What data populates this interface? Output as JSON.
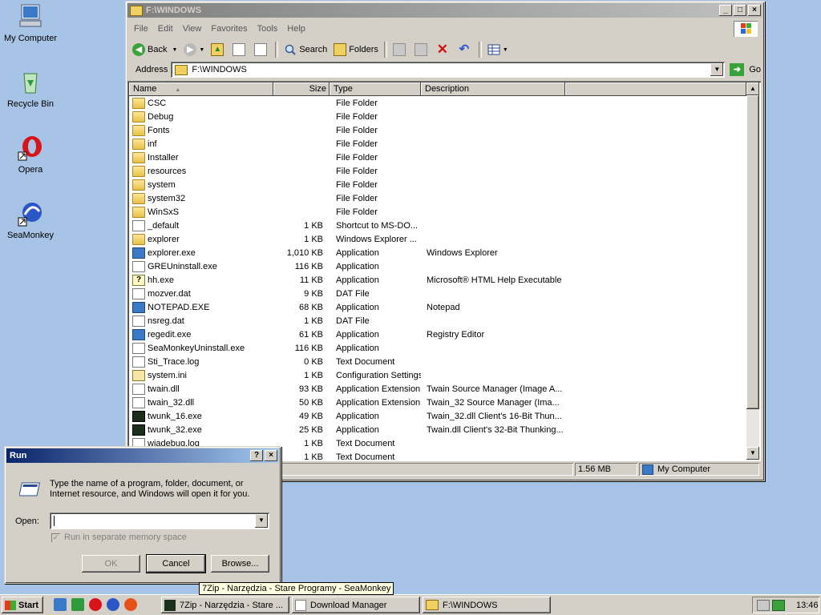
{
  "desktop": {
    "icons": [
      {
        "label": "My Computer"
      },
      {
        "label": "Recycle Bin"
      },
      {
        "label": "Opera"
      },
      {
        "label": "SeaMonkey"
      }
    ]
  },
  "explorer": {
    "title": "F:\\WINDOWS",
    "menu": [
      "File",
      "Edit",
      "View",
      "Favorites",
      "Tools",
      "Help"
    ],
    "toolbar": {
      "back": "Back",
      "search": "Search",
      "folders": "Folders"
    },
    "address": {
      "label": "Address",
      "value": "F:\\WINDOWS",
      "go": "Go"
    },
    "columns": {
      "name": "Name",
      "size": "Size",
      "type": "Type",
      "description": "Description"
    },
    "files": [
      {
        "name": "CSC",
        "size": "",
        "type": "File Folder",
        "desc": "",
        "icon": "folder"
      },
      {
        "name": "Debug",
        "size": "",
        "type": "File Folder",
        "desc": "",
        "icon": "folder"
      },
      {
        "name": "Fonts",
        "size": "",
        "type": "File Folder",
        "desc": "",
        "icon": "folder"
      },
      {
        "name": "inf",
        "size": "",
        "type": "File Folder",
        "desc": "",
        "icon": "folder"
      },
      {
        "name": "Installer",
        "size": "",
        "type": "File Folder",
        "desc": "",
        "icon": "folder"
      },
      {
        "name": "resources",
        "size": "",
        "type": "File Folder",
        "desc": "",
        "icon": "folder"
      },
      {
        "name": "system",
        "size": "",
        "type": "File Folder",
        "desc": "",
        "icon": "folder"
      },
      {
        "name": "system32",
        "size": "",
        "type": "File Folder",
        "desc": "",
        "icon": "folder"
      },
      {
        "name": "WinSxS",
        "size": "",
        "type": "File Folder",
        "desc": "",
        "icon": "folder"
      },
      {
        "name": "_default",
        "size": "1 KB",
        "type": "Shortcut to MS-DO...",
        "desc": "",
        "icon": "file"
      },
      {
        "name": "explorer",
        "size": "1 KB",
        "type": "Windows Explorer ...",
        "desc": "",
        "icon": "folder"
      },
      {
        "name": "explorer.exe",
        "size": "1,010 KB",
        "type": "Application",
        "desc": "Windows Explorer",
        "icon": "app"
      },
      {
        "name": "GREUninstall.exe",
        "size": "116 KB",
        "type": "Application",
        "desc": "",
        "icon": "file"
      },
      {
        "name": "hh.exe",
        "size": "11 KB",
        "type": "Application",
        "desc": "Microsoft® HTML Help Executable",
        "icon": "help"
      },
      {
        "name": "mozver.dat",
        "size": "9 KB",
        "type": "DAT File",
        "desc": "",
        "icon": "file"
      },
      {
        "name": "NOTEPAD.EXE",
        "size": "68 KB",
        "type": "Application",
        "desc": "Notepad",
        "icon": "app"
      },
      {
        "name": "nsreg.dat",
        "size": "1 KB",
        "type": "DAT File",
        "desc": "",
        "icon": "file"
      },
      {
        "name": "regedit.exe",
        "size": "61 KB",
        "type": "Application",
        "desc": "Registry Editor",
        "icon": "app"
      },
      {
        "name": "SeaMonkeyUninstall.exe",
        "size": "116 KB",
        "type": "Application",
        "desc": "",
        "icon": "file"
      },
      {
        "name": "Sti_Trace.log",
        "size": "0 KB",
        "type": "Text Document",
        "desc": "",
        "icon": "file"
      },
      {
        "name": "system.ini",
        "size": "1 KB",
        "type": "Configuration Settings",
        "desc": "",
        "icon": "cfg"
      },
      {
        "name": "twain.dll",
        "size": "93 KB",
        "type": "Application Extension",
        "desc": "Twain Source Manager (Image A...",
        "icon": "file"
      },
      {
        "name": "twain_32.dll",
        "size": "50 KB",
        "type": "Application Extension",
        "desc": "Twain_32 Source Manager (Ima...",
        "icon": "file"
      },
      {
        "name": "twunk_16.exe",
        "size": "49 KB",
        "type": "Application",
        "desc": "Twain_32.dll Client's 16-Bit Thun...",
        "icon": "dark"
      },
      {
        "name": "twunk_32.exe",
        "size": "25 KB",
        "type": "Application",
        "desc": "Twain.dll Client's 32-Bit Thunking...",
        "icon": "dark"
      },
      {
        "name": "wiadebug.log",
        "size": "1 KB",
        "type": "Text Document",
        "desc": "",
        "icon": "file"
      },
      {
        "name": "",
        "size": "1 KB",
        "type": "Text Document",
        "desc": "",
        "icon": "file"
      }
    ],
    "status": {
      "size": "1.56 MB",
      "zone": "My Computer"
    }
  },
  "run": {
    "title": "Run",
    "description": "Type the name of a program, folder, document, or Internet resource, and Windows will open it for you.",
    "open_label": "Open:",
    "open_value": "",
    "checkbox_label": "Run in separate memory space",
    "ok": "OK",
    "cancel": "Cancel",
    "browse": "Browse..."
  },
  "taskbar": {
    "start": "Start",
    "tasks": [
      {
        "label": "7Zip - Narzędzia - Stare ..."
      },
      {
        "label": "Download Manager"
      },
      {
        "label": "F:\\WINDOWS"
      }
    ],
    "clock": "13:46",
    "tooltip": "7Zip - Narzędzia - Stare Programy - SeaMonkey"
  }
}
